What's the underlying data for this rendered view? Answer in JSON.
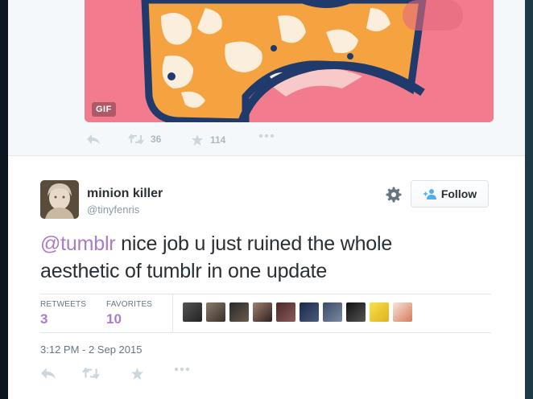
{
  "previous_tweet": {
    "media_badge": "GIF",
    "retweet_count": "36",
    "favorite_count": "114"
  },
  "tweet": {
    "author": {
      "fullname": "minion killer",
      "username": "@tinyfenris"
    },
    "follow_label": "Follow",
    "text_mention": "@tumblr",
    "text_body": " nice job u just ruined the whole aesthetic of tumblr in one update",
    "stats": {
      "retweets_label": "RETWEETS",
      "retweets_value": "3",
      "favorites_label": "FAVORITES",
      "favorites_value": "10"
    },
    "timestamp": "3:12 PM - 2 Sep 2015",
    "favoriter_avatars": [
      "avatar-1",
      "avatar-2",
      "avatar-3",
      "avatar-4",
      "avatar-5",
      "avatar-6",
      "avatar-7",
      "avatar-8",
      "avatar-9",
      "avatar-10"
    ]
  },
  "colors": {
    "accent_purple": "#a97cc5",
    "gif_pink": "#f27c8e",
    "gif_orange": "#f4a340",
    "gif_navy": "#1f3a6b"
  }
}
